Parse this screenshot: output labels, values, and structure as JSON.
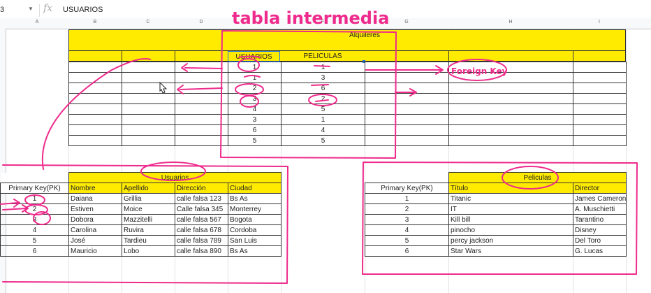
{
  "formula_bar": {
    "name_box": "3",
    "fx": "fx",
    "value": "USUARIOS"
  },
  "columns": [
    "A",
    "B",
    "C",
    "D",
    "E",
    "F",
    "G",
    "H",
    "I"
  ],
  "annotations": {
    "title": "tabla intermedia",
    "foreign_key": "Foreign Key"
  },
  "alquileres": {
    "title": "Alquileres",
    "headers": [
      "USUARIOS",
      "PELICULAS"
    ],
    "rows": [
      [
        "1",
        "1"
      ],
      [
        "1",
        "3"
      ],
      [
        "2",
        "6"
      ],
      [
        "3",
        "2"
      ],
      [
        "4",
        "5"
      ],
      [
        "3",
        "1"
      ],
      [
        "6",
        "4"
      ],
      [
        "5",
        "5"
      ]
    ]
  },
  "usuarios": {
    "title": "Usuarios",
    "headers": [
      "Primary Key(PK)",
      "Nombre",
      "Apellido",
      "Dirección",
      "Ciudad"
    ],
    "rows": [
      [
        "1",
        "Daiana",
        "Grillia",
        "calle falsa 123",
        "Bs As"
      ],
      [
        "2",
        "Estiven",
        "Moice",
        "Calle falsa 345",
        "Monterrey"
      ],
      [
        "3",
        "Dobora",
        "Mazzitelli",
        "calle falsa 567",
        "Bogota"
      ],
      [
        "4",
        "Carolina",
        "Ruvira",
        "calle falsa 678",
        "Cordoba"
      ],
      [
        "5",
        "José",
        "Tardieu",
        "calle falsa 789",
        "San Luis"
      ],
      [
        "6",
        "Mauricio",
        "Lobo",
        "calle falsa 890",
        "Bs As"
      ]
    ]
  },
  "peliculas": {
    "title": "Peliculas",
    "headers": [
      "Primary Key(PK)",
      "Título",
      "Director"
    ],
    "rows": [
      [
        "1",
        "Titanic",
        "James Cameron"
      ],
      [
        "2",
        "IT",
        "A. Muschietti"
      ],
      [
        "3",
        "Kill bill",
        "Tarantino"
      ],
      [
        "4",
        "pinocho",
        "Disney"
      ],
      [
        "5",
        "percy jackson",
        "Del Toro"
      ],
      [
        "6",
        "Star Wars",
        "G. Lucas"
      ]
    ]
  },
  "colors": {
    "highlight": "#ffeb00",
    "ink": "#ee2b8c"
  }
}
